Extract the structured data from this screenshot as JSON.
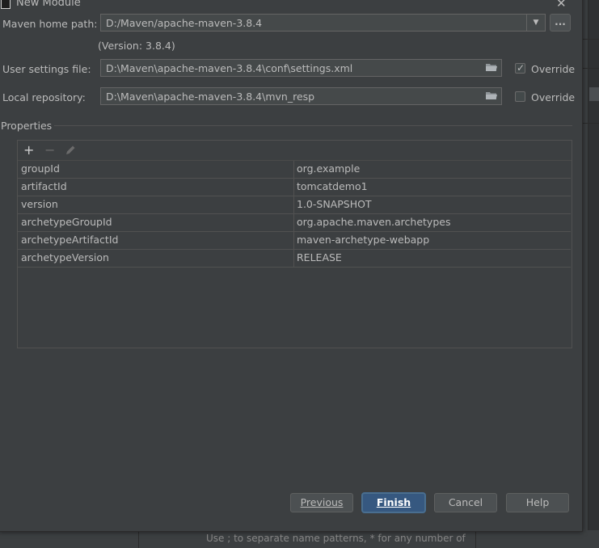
{
  "window": {
    "title": "New Module",
    "close_icon": "close-icon"
  },
  "maven_home": {
    "label": "Maven home path:",
    "value": "D:/Maven/apache-maven-3.8.4",
    "version_note": "(Version: 3.8.4)",
    "browse_label": "..."
  },
  "user_settings": {
    "label": "User settings file:",
    "value": "D:\\Maven\\apache-maven-3.8.4\\conf\\settings.xml",
    "override_label": "Override",
    "override_checked": true
  },
  "local_repo": {
    "label": "Local repository:",
    "value": "D:\\Maven\\apache-maven-3.8.4\\mvn_resp",
    "override_label": "Override",
    "override_checked": false
  },
  "properties": {
    "section_title": "Properties",
    "toolbar": {
      "add_icon": "plus-icon",
      "remove_icon": "minus-icon",
      "edit_icon": "pencil-icon"
    },
    "rows": [
      {
        "key": "groupId",
        "value": "org.example"
      },
      {
        "key": "artifactId",
        "value": "tomcatdemo1"
      },
      {
        "key": "version",
        "value": "1.0-SNAPSHOT"
      },
      {
        "key": "archetypeGroupId",
        "value": "org.apache.maven.archetypes"
      },
      {
        "key": "archetypeArtifactId",
        "value": "maven-archetype-webapp"
      },
      {
        "key": "archetypeVersion",
        "value": "RELEASE"
      }
    ]
  },
  "buttons": {
    "previous": "Previous",
    "finish": "Finish",
    "cancel": "Cancel",
    "help": "Help"
  },
  "background": {
    "hint_text": "Use ; to separate name patterns, * for any number of"
  },
  "colors": {
    "dialog_bg": "#3c3f41",
    "field_bg": "#45494a",
    "primary_button": "#365880",
    "text": "#bbbbbb"
  }
}
